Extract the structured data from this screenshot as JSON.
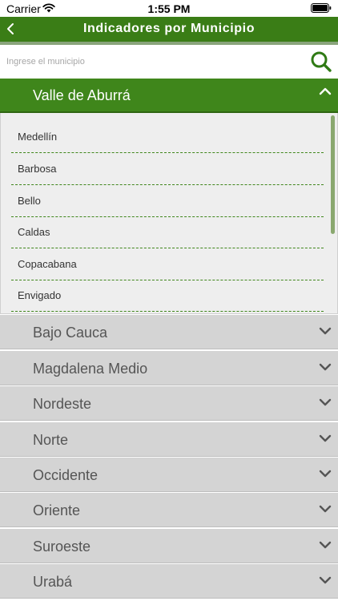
{
  "status_bar": {
    "carrier": "Carrier",
    "time": "1:55 PM"
  },
  "nav": {
    "title": "Indicadores por Municipio"
  },
  "search": {
    "value": "",
    "placeholder": "Ingrese el municipio"
  },
  "expanded_region": {
    "name": "Valle de Aburrá",
    "municipalities": [
      "Medellín",
      "Barbosa",
      "Bello",
      "Caldas",
      "Copacabana",
      "Envigado"
    ]
  },
  "regions": [
    {
      "name": "Bajo Cauca"
    },
    {
      "name": "Magdalena Medio"
    },
    {
      "name": "Nordeste"
    },
    {
      "name": "Norte"
    },
    {
      "name": "Occidente"
    },
    {
      "name": "Oriente"
    },
    {
      "name": "Suroeste"
    },
    {
      "name": "Urabá"
    }
  ],
  "colors": {
    "primary_green": "#3a7d16",
    "header_green": "#3f861b",
    "collapsed_row": "#d4d4d4",
    "sub_list_bg": "#eeeeee"
  }
}
